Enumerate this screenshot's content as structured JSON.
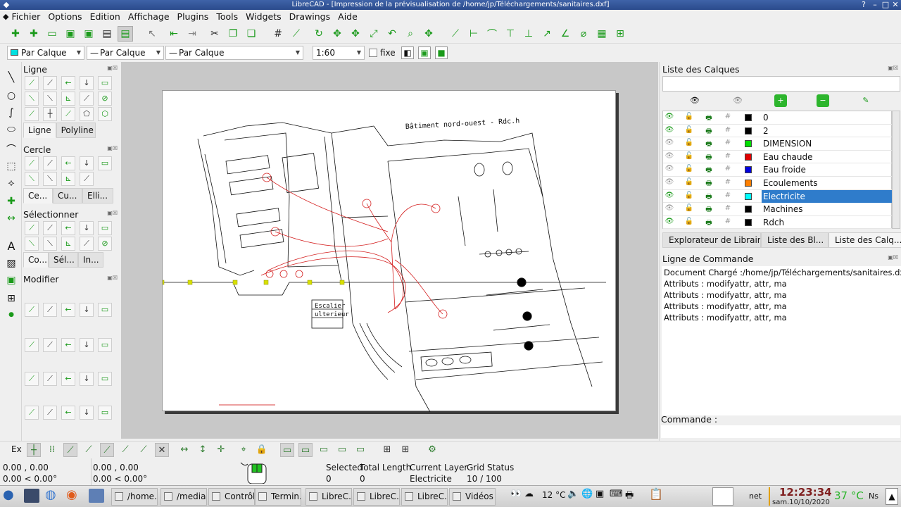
{
  "window": {
    "title": "LibreCAD - [Impression de la prévisualisation de /home/jp/Téléchargements/sanitaires.dxf]"
  },
  "menu": [
    "Fichier",
    "Options",
    "Edition",
    "Affichage",
    "Plugins",
    "Tools",
    "Widgets",
    "Drawings",
    "Aide"
  ],
  "pen_toolbar": {
    "color": "Par Calque",
    "line_type": "Par Calque",
    "line_width": "Par Calque",
    "scale": "1:60",
    "fixed_label": "fixe"
  },
  "left_panels": {
    "ligne": {
      "title": "Ligne",
      "tabs": [
        "Ligne",
        "Polyline"
      ]
    },
    "cercle": {
      "title": "Cercle",
      "tabs": [
        "Ce...",
        "Cu...",
        "Elli..."
      ]
    },
    "selectionner": {
      "title": "Sélectionner",
      "tabs": [
        "Co...",
        "Sél...",
        "In..."
      ]
    },
    "modifier": {
      "title": "Modifier"
    }
  },
  "drawing": {
    "title_text": "Bâtiment nord-ouest - Rdc.h",
    "stair_label_1": "Escalier",
    "stair_label_2": "ulterieur"
  },
  "layers": {
    "title": "Liste des Calques",
    "rows": [
      {
        "name": "0",
        "color": "#000000",
        "visible": true
      },
      {
        "name": "2",
        "color": "#000000",
        "visible": true
      },
      {
        "name": "DIMENSION",
        "color": "#00e000",
        "visible": false
      },
      {
        "name": "Eau chaude",
        "color": "#e00000",
        "visible": false
      },
      {
        "name": "Eau froide",
        "color": "#0000e0",
        "visible": false
      },
      {
        "name": "Ecoulements",
        "color": "#ff8000",
        "visible": false
      },
      {
        "name": "Electricite",
        "color": "#00ffff",
        "visible": true,
        "selected": true
      },
      {
        "name": "Machines",
        "color": "#000000",
        "visible": false
      },
      {
        "name": "Rdch",
        "color": "#000000",
        "visible": true
      }
    ]
  },
  "dock_tabs": [
    "Explorateur de Librair...",
    "Liste des Bl...",
    "Liste des Calq..."
  ],
  "command": {
    "title": "Ligne de Commande",
    "log": [
      "Document Chargé :/home/jp/Téléchargements/sanitaires.dxf",
      "Attributs : modifyattr, attr, ma",
      "Attributs : modifyattr, attr, ma",
      "Attributs : modifyattr, attr, ma",
      "Attributs : modifyattr, attr, ma"
    ],
    "input_label": "Commande :"
  },
  "snap": {
    "label": "Ex"
  },
  "status": {
    "coord_abs": "0.00 , 0.00",
    "coord_abs_polar": "0.00 < 0.00°",
    "coord_rel": "0.00 , 0.00",
    "coord_rel_polar": "0.00 < 0.00°",
    "selected_label": "Selected",
    "selected_value": "0",
    "length_label": "Total Length",
    "length_value": "0",
    "layer_label": "Current Layer",
    "layer_value": "Electricite",
    "grid_label": "Grid Status",
    "grid_value": "10 / 100"
  },
  "taskbar": {
    "tasks": [
      "/home...",
      "/media...",
      "Contrôl...",
      "Termin...",
      "LibreC...",
      "LibreC...",
      "LibreC...",
      "Vidéos ..."
    ],
    "weather": "12 °C",
    "net": "net",
    "time": "12:23:34",
    "date": "sam.10/10/2020",
    "cpu_temp": "37 °C",
    "cpu_label": "Ns"
  }
}
